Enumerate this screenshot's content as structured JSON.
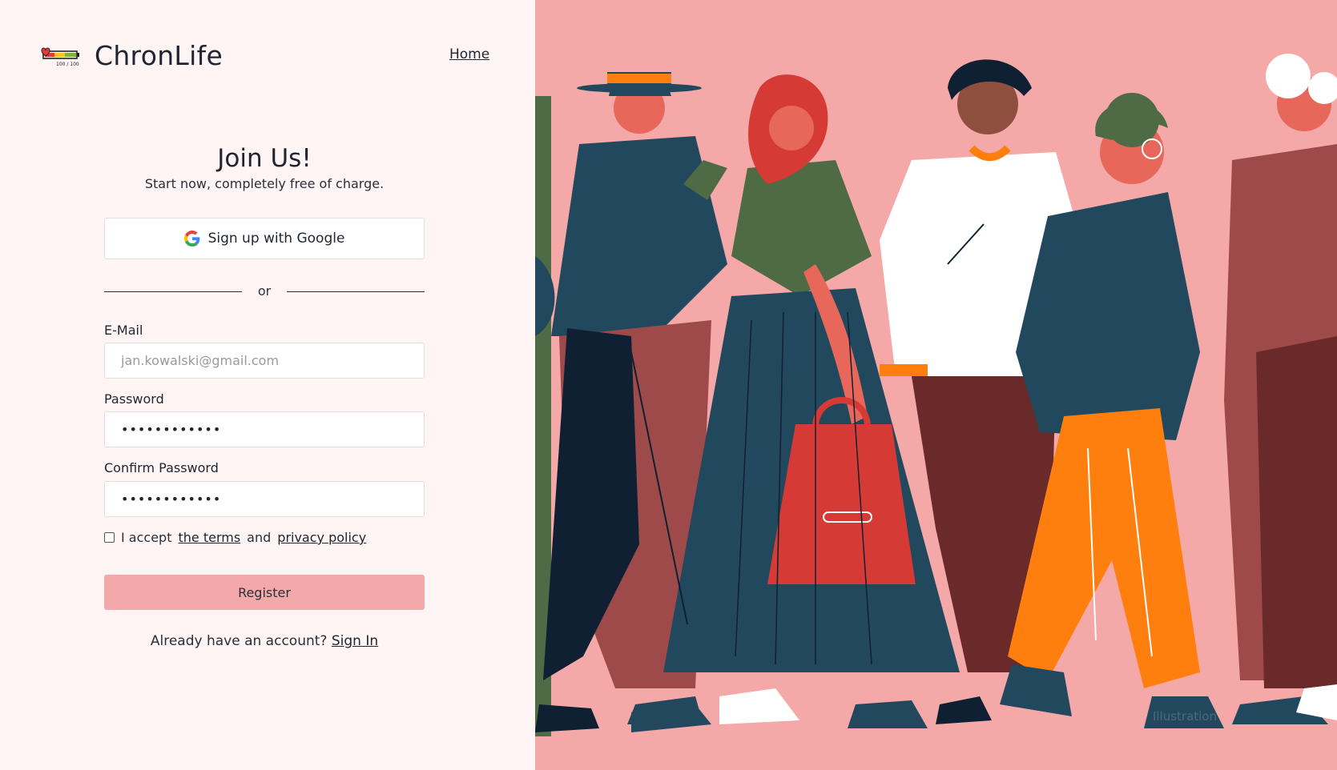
{
  "brand": {
    "name": "ChronLife",
    "logo_badge": "100 / 100"
  },
  "nav": {
    "home_label": "Home"
  },
  "form": {
    "title": "Join Us!",
    "subtitle": "Start now, completely free of charge.",
    "google_button_label": "Sign up with Google",
    "divider_label": "or",
    "email": {
      "label": "E-Mail",
      "placeholder": "jan.kowalski@gmail.com"
    },
    "password": {
      "label": "Password",
      "value": "••••••••••••"
    },
    "confirm_password": {
      "label": "Confirm Password",
      "value": "••••••••••••"
    },
    "terms": {
      "prefix": "I accept",
      "terms_link": "the terms",
      "and": "and",
      "privacy_link": "privacy policy",
      "checked": false
    },
    "register_label": "Register",
    "signin_prompt": "Already have an account?",
    "signin_link": "Sign In"
  },
  "illustration": {
    "caption": "Illustration"
  },
  "colors": {
    "left_bg": "#fff5f5",
    "illustration_bg": "#f4a8a8",
    "register_button": "#f3a9a9",
    "text": "#1f2430"
  }
}
